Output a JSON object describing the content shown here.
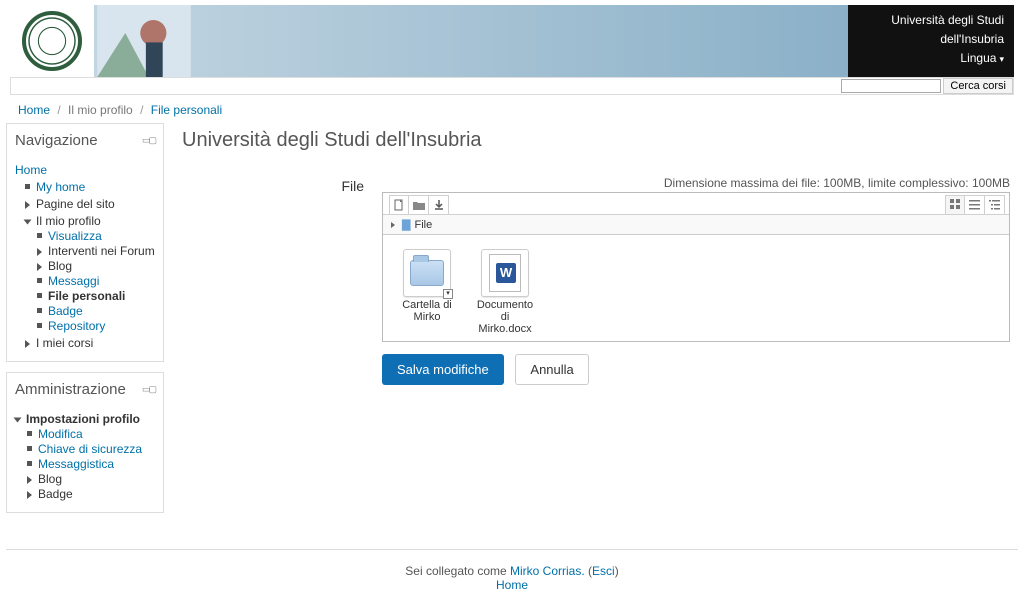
{
  "header": {
    "org": "Università degli Studi dell'Insubria",
    "lang_label": "Lingua",
    "user": "Mirko Corrias"
  },
  "search": {
    "placeholder": "",
    "button": "Cerca corsi"
  },
  "breadcrumb": {
    "home": "Home",
    "mid": "Il mio profilo",
    "current": "File personali"
  },
  "page": {
    "title": "Università degli Studi dell'Insubria"
  },
  "nav_block": {
    "title": "Navigazione",
    "home": "Home",
    "myhome": "My home",
    "pagine": "Pagine del sito",
    "profilo": "Il mio profilo",
    "visualizza": "Visualizza",
    "interventi": "Interventi nei Forum",
    "blog": "Blog",
    "messaggi": "Messaggi",
    "filepersonali": "File personali",
    "badge": "Badge",
    "repository": "Repository",
    "miei_corsi": "I miei corsi"
  },
  "admin_block": {
    "title": "Amministrazione",
    "impostazioni": "Impostazioni profilo",
    "modifica": "Modifica",
    "chiave": "Chiave di sicurezza",
    "messaggistica": "Messaggistica",
    "blog": "Blog",
    "badge": "Badge"
  },
  "form": {
    "label_file": "File",
    "hint": "Dimensione massima dei file: 100MB, limite complessivo: 100MB",
    "path_root": "File",
    "item1": "Cartella di Mirko",
    "item2_l1": "Documento di",
    "item2_l2": "Mirko.docx",
    "save": "Salva modifiche",
    "cancel": "Annulla"
  },
  "footer": {
    "pre": "Sei collegato come ",
    "user": "Mirko Corrias.",
    "esci": "Esci",
    "home": "Home"
  }
}
